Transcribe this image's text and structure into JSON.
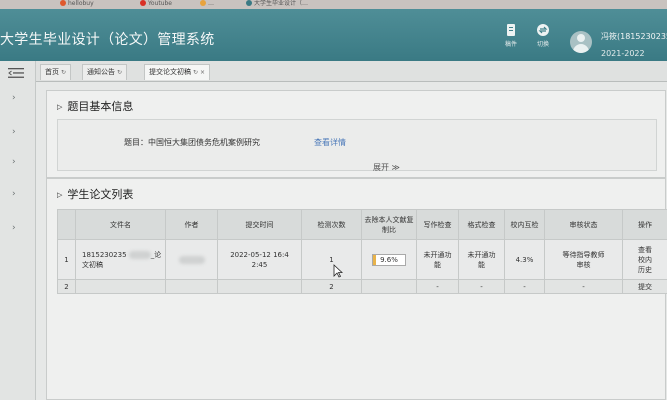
{
  "browser_tabs": [
    {
      "label": "hellobuy",
      "color": "#e0582c"
    },
    {
      "label": "Youtube",
      "color": "#d93025"
    },
    {
      "label": "…",
      "color": "#e8a33d"
    },
    {
      "label": "大学生毕业设计（…",
      "color": "#3a7a84"
    }
  ],
  "header": {
    "app_title": "大学生毕业设计（论文）管理系统",
    "btn_save": "稿件",
    "btn_switch": "切换",
    "user_name": "冯筱(1815230235",
    "user_term": "2021-2022"
  },
  "tabs": [
    {
      "label": "首页"
    },
    {
      "label": "通知公告"
    },
    {
      "label": "提交论文初稿"
    }
  ],
  "topic_section": {
    "heading": "题目基本信息",
    "topic_label": "题目：中国恒大集团债务危机案例研究",
    "view_detail": "查看详情",
    "expand": "展开 ≫"
  },
  "paper_section": {
    "heading": "学生论文列表",
    "columns": [
      "",
      "文件名",
      "作者",
      "提交时间",
      "检测次数",
      "去除本人文献复制比",
      "写作检查",
      "格式检查",
      "校内互检",
      "审核状态",
      "操作"
    ],
    "rows": [
      {
        "no": "1",
        "file_name_1": "1815230235",
        "file_name_suffix": "_论",
        "file_name_2": "文初稿",
        "submit_time_1": "2022-05-12 16:4",
        "submit_time_2": "2:45",
        "check_count": "1",
        "ratio_text": "9.6%",
        "ratio": 0.096,
        "writing_check_1": "未开通功",
        "writing_check_2": "能",
        "format_check_1": "未开通功",
        "format_check_2": "能",
        "internal_check": "4.3%",
        "status_1": "等待指导教师",
        "status_2": "审核",
        "op_1": "查看",
        "op_2": "校内",
        "op_3": "历史"
      },
      {
        "no": "2",
        "check_count": "2",
        "writing_check": "-",
        "format_check": "-",
        "internal_check": "-",
        "status": "-",
        "op": "提交"
      }
    ]
  },
  "colors": {
    "header": "#3f8089",
    "link": "#4a78b8",
    "status_red": "#c0392b",
    "ratio_fill": "#e8b34a"
  }
}
